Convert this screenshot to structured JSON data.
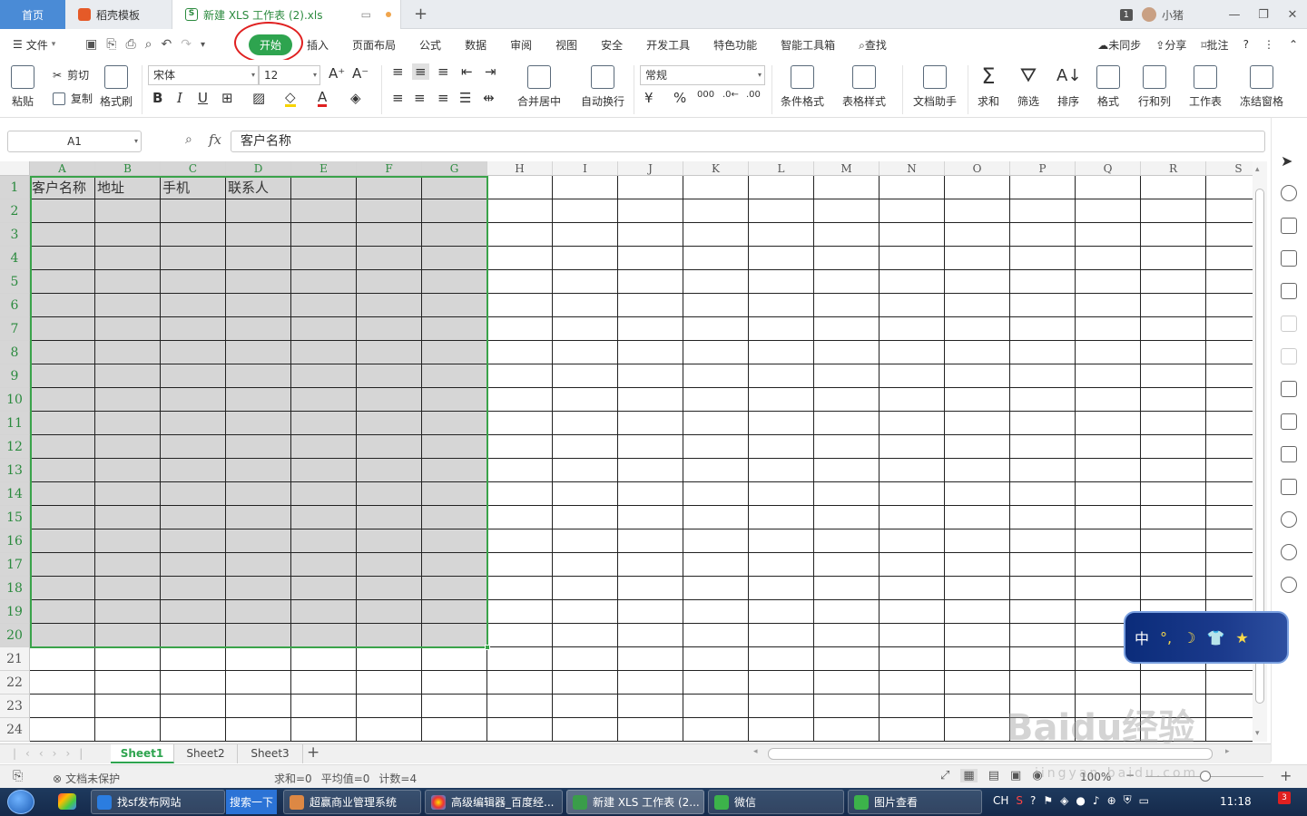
{
  "tabs": {
    "home": "首页",
    "templates": "稻壳模板",
    "active_doc": "新建 XLS 工作表 (2).xls",
    "new_tab": "+"
  },
  "titlebar": {
    "badge": "1",
    "user": "小猪"
  },
  "menu": {
    "file": "文件",
    "items": [
      "开始",
      "插入",
      "页面布局",
      "公式",
      "数据",
      "审阅",
      "视图",
      "安全",
      "开发工具",
      "特色功能",
      "智能工具箱"
    ],
    "search": "查找",
    "sync": "未同步",
    "share": "分享",
    "comment": "批注"
  },
  "ribbon": {
    "paste": "粘贴",
    "cut": "剪切",
    "copy": "复制",
    "format_painter": "格式刷",
    "font_name": "宋体",
    "font_size": "12",
    "number_format": "常规",
    "merge_center": "合并居中",
    "wrap_text": "自动换行",
    "conditional_format": "条件格式",
    "table_style": "表格样式",
    "doc_assistant": "文档助手",
    "sum": "求和",
    "filter": "筛选",
    "sort": "排序",
    "format": "格式",
    "row_col": "行和列",
    "worksheet": "工作表",
    "freeze": "冻结窗格"
  },
  "formula_bar": {
    "name_box": "A1",
    "fx": "fx",
    "content": "客户名称"
  },
  "sheet": {
    "columns": [
      "A",
      "B",
      "C",
      "D",
      "E",
      "F",
      "G",
      "H",
      "I",
      "J",
      "K",
      "L",
      "M",
      "N",
      "O",
      "P",
      "Q",
      "R",
      "S"
    ],
    "rows": [
      "1",
      "2",
      "3",
      "4",
      "5",
      "6",
      "7",
      "8",
      "9",
      "10",
      "11",
      "12",
      "13",
      "14",
      "15",
      "16",
      "17",
      "18",
      "19",
      "20",
      "21",
      "22",
      "23",
      "24"
    ],
    "header_cells": [
      "客户名称",
      "地址",
      "手机",
      "联系人"
    ],
    "selection": "A1:G20"
  },
  "sheet_tabs": [
    "Sheet1",
    "Sheet2",
    "Sheet3"
  ],
  "status": {
    "protection": "文档未保护",
    "sum": "求和=0",
    "average": "平均值=0",
    "count": "计数=4",
    "zoom": "100%"
  },
  "ime": {
    "label": "中"
  },
  "taskbar": {
    "items": [
      "找sf发布网站",
      "超赢商业管理系统",
      "高级编辑器_百度经...",
      "新建 XLS 工作表 (2...",
      "微信",
      "图片查看"
    ],
    "search": "搜索一下",
    "lang": "CH",
    "time": "11:18",
    "notif": "3"
  },
  "watermark": {
    "text": "Baidu经验",
    "sub": "jingyan.baidu.com"
  }
}
